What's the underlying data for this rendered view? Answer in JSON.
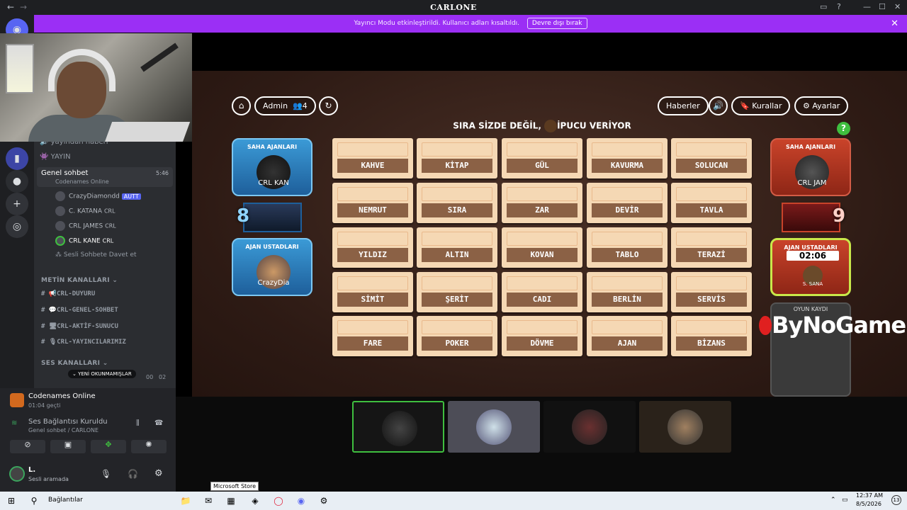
{
  "window": {
    "title": "CARLONE",
    "nav_back": "←",
    "nav_fwd": "→",
    "controls": [
      "▭",
      "?",
      "—",
      "☐",
      "✕"
    ]
  },
  "streamer_banner": {
    "text": "Yayıncı Modu etkinleştirildi. Kullanıcı adları kısaltıldı.",
    "button": "Devre dışı bırak",
    "close": "✕"
  },
  "sidebar": {
    "partial_top": "yayından haberi",
    "yayin": "YAYIN",
    "voice_channel": {
      "name": "Genel sohbet",
      "time": "5:46",
      "activity": "Codenames Online"
    },
    "voice_users": [
      {
        "name": "CrazyDiamondd",
        "tag": "AUTT"
      },
      {
        "name": "C. KATANA",
        "tag": "CRL"
      },
      {
        "name": "CRL JAMES",
        "tag": "CRL"
      },
      {
        "name": "CRL KANE",
        "tag": "CRL"
      }
    ],
    "invite": "Sesli Sohbete Davet et",
    "text_category": "METİN KANALLARI",
    "text_channels": [
      "CRL-DUYURU",
      "CRL-GENEL-SOHBET",
      "CRL-AKTİF-SUNUCU",
      "CRL-YAYINCILARIMIZ"
    ],
    "voice_category": "SES KANALLARI",
    "unread": "YENİ OKUNMAMIŞLAR",
    "unread_counts": [
      "00",
      "02"
    ]
  },
  "panel": {
    "activity_title": "Codenames Online",
    "activity_time": "01:04 geçti",
    "connection_title": "Ses Bağlantısı Kuruldu",
    "connection_sub": "Genel sohbet / CARLONE",
    "user_name": "L.",
    "user_status": "Sesli aramada"
  },
  "game": {
    "admin_label": "Admin",
    "player_count": "4",
    "news_label": "Haberler",
    "rules_label": "Kurallar",
    "settings_label": "Ayarlar",
    "turn_text": "SIRA SİZDE DEĞİL,",
    "turn_text2": "İPUCU VERİYOR",
    "blue_operatives_title": "SAHA AJANLARI",
    "blue_operatives_name": "CRL KAN",
    "blue_spymaster_title": "AJAN USTADLARI",
    "blue_spymaster_name": "CrazyDia",
    "blue_score": "8",
    "red_operatives_title": "SAHA AJANLARI",
    "red_operatives_name": "CRL JAM",
    "red_spymaster_title": "AJAN USTADLARI",
    "red_timer": "02:06",
    "red_spymaster_name": "S. SANA",
    "red_score": "9",
    "replay_title": "OYUN KAYDI",
    "logo": "ByNoGame",
    "cards": [
      [
        "KAHVE",
        "KİTAP",
        "GÜL",
        "KAVURMA",
        "SOLUCAN"
      ],
      [
        "NEMRUT",
        "SIRA",
        "ZAR",
        "DEVİR",
        "TAVLA"
      ],
      [
        "YILDIZ",
        "ALTIN",
        "KOVAN",
        "TABLO",
        "TERAZİ"
      ],
      [
        "SİMİT",
        "ŞERİT",
        "CADI",
        "BERLİN",
        "SERVİS"
      ],
      [
        "FARE",
        "POKER",
        "DÖVME",
        "AJAN",
        "BİZANS"
      ]
    ]
  },
  "taskbar": {
    "search_label": "Bağlantılar",
    "tooltip": "Microsoft Store",
    "time": "12:37 AM",
    "date": "8/5/2026",
    "notif": "13"
  }
}
